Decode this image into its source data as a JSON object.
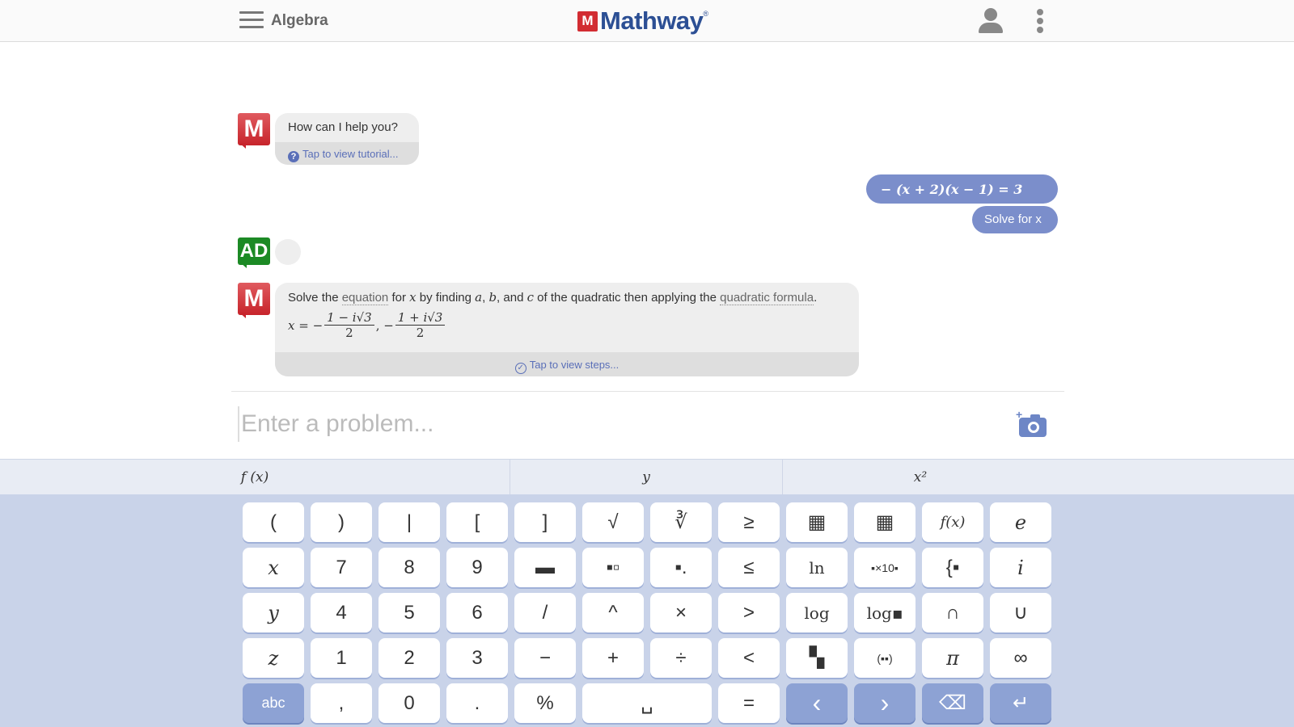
{
  "header": {
    "subject": "Algebra",
    "logo_mark": "M",
    "logo_text": "Mathway",
    "logo_tm": "®"
  },
  "chat": {
    "greeting": {
      "avatar": "M",
      "text": "How can I help you?",
      "tutorial_link": "Tap to view tutorial..."
    },
    "user_problem": {
      "expression": "− (x + 2)(x − 1) = 3",
      "action": "Solve for x"
    },
    "ad": {
      "label": "AD"
    },
    "answer": {
      "avatar": "M",
      "intro_1": "Solve the ",
      "link_equation": "equation",
      "intro_2": " for ",
      "var_x": "x",
      "intro_3": " by finding ",
      "var_a": "a",
      "comma_1": ", ",
      "var_b": "b",
      "intro_4": ", and ",
      "var_c": "c",
      "intro_5": " of the quadratic then applying the ",
      "link_formula": "quadratic formula",
      "period": ".",
      "result_lhs": "x = −",
      "frac1_num": "1 − i√3",
      "frac1_den": "2",
      "sep": ", −",
      "frac2_num": "1 + i√3",
      "frac2_den": "2",
      "steps_link": "Tap to view steps..."
    }
  },
  "input": {
    "placeholder": "Enter a problem..."
  },
  "tabs": [
    "f (x)",
    "y",
    "x²"
  ],
  "keys": [
    [
      "(",
      ")",
      "|",
      "[",
      "]",
      "√",
      "∛",
      "≥",
      "▦",
      "▦",
      "f(x)",
      "e"
    ],
    [
      "x",
      "7",
      "8",
      "9",
      "▬",
      "▪▫",
      "▪.",
      "≤",
      "ln",
      "▪×10▪",
      "{▪",
      "i"
    ],
    [
      "y",
      "4",
      "5",
      "6",
      "/",
      "^",
      "×",
      ">",
      "log",
      "log▪",
      "∩",
      "∪"
    ],
    [
      "z",
      "1",
      "2",
      "3",
      "−",
      "+",
      "÷",
      "<",
      "▚",
      "(▪▪)",
      "π",
      "∞"
    ],
    [
      "abc",
      ",",
      "0",
      ".",
      "%",
      "␣",
      "=",
      "‹",
      "›",
      "⌫",
      "↵"
    ]
  ],
  "colors": {
    "accent": "#7b8ecb",
    "keypad_bg": "#c9d3e9",
    "brand_red": "#d22c32",
    "brand_blue": "#2c4f94",
    "ad_green": "#1c8a25"
  }
}
